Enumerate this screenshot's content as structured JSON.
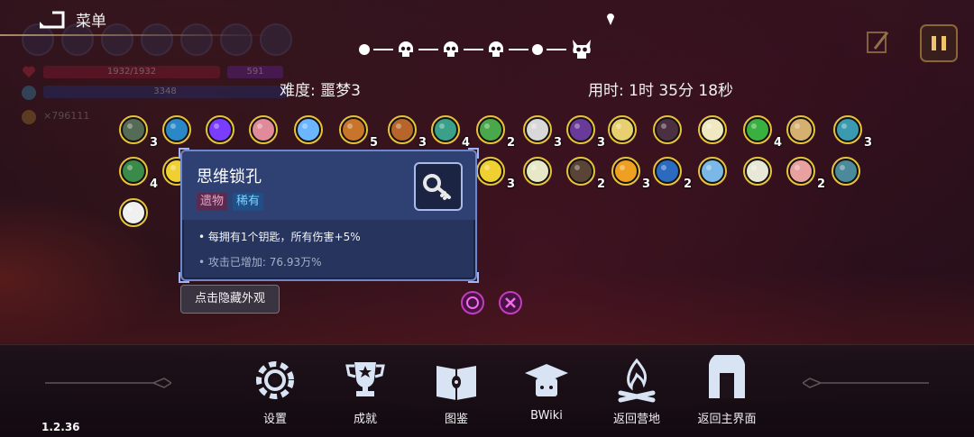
{
  "menu": {
    "label": "菜单"
  },
  "hud": {
    "hp": "1932/1932",
    "shield": "591",
    "mana": "3348",
    "coins": "×796111"
  },
  "progress": {
    "nodes": [
      "dot",
      "skull",
      "skull",
      "skull",
      "dot",
      "boss-skull"
    ]
  },
  "run": {
    "difficulty": "难度: 噩梦3",
    "time": "用时: 1时 35分 18秒"
  },
  "relics": [
    {
      "icon": "gas-mask-icon",
      "count": "3"
    },
    {
      "icon": "magnifier-icon",
      "count": ""
    },
    {
      "icon": "rainbow-cape-icon",
      "count": ""
    },
    {
      "icon": "brain-icon",
      "count": ""
    },
    {
      "icon": "crystal-amulet-icon",
      "count": ""
    },
    {
      "icon": "pickaxe-icon",
      "count": "5"
    },
    {
      "icon": "scroll-icon",
      "count": "3"
    },
    {
      "icon": "sword-icon",
      "count": "4"
    },
    {
      "icon": "leaf-blade-icon",
      "count": "2"
    },
    {
      "icon": "ribcage-icon",
      "count": "3"
    },
    {
      "icon": "robe-icon",
      "count": "3"
    },
    {
      "icon": "goggles-icon",
      "count": ""
    },
    {
      "icon": "dark-cloak-icon",
      "count": ""
    },
    {
      "icon": "wings-icon",
      "count": ""
    },
    {
      "icon": "clover-icon",
      "count": "4"
    },
    {
      "icon": "bread-icon",
      "count": ""
    },
    {
      "icon": "cube-icon",
      "count": "3"
    },
    {
      "icon": "belt-icon",
      "count": "4"
    },
    {
      "icon": "lightning-icon",
      "count": ""
    },
    {
      "icon": "lightning-icon",
      "count": "3"
    },
    {
      "icon": "key-icon",
      "count": ""
    },
    {
      "icon": "cloak-icon",
      "count": "2"
    },
    {
      "icon": "candy-corn-icon",
      "count": "3"
    },
    {
      "icon": "glove-icon",
      "count": "2"
    },
    {
      "icon": "blue-key-icon",
      "count": ""
    },
    {
      "icon": "feather-icon",
      "count": ""
    },
    {
      "icon": "horn-icon",
      "count": "2"
    },
    {
      "icon": "compass-icon",
      "count": ""
    },
    {
      "icon": "mask-icon",
      "count": ""
    }
  ],
  "tooltip": {
    "title": "思维锁孔",
    "tag_relic": "遗物",
    "tag_rare": "稀有",
    "line1": "• 每拥有1个钥匙，所有伤害+5%",
    "line2": "• 攻击已增加: 76.93万%",
    "icon": "key-icon"
  },
  "hide_button": "点击隐藏外观",
  "nav": [
    {
      "label": "设置",
      "icon": "gear-icon"
    },
    {
      "label": "成就",
      "icon": "trophy-icon"
    },
    {
      "label": "图鉴",
      "icon": "book-icon"
    },
    {
      "label": "BWiki",
      "icon": "graduation-cap-icon"
    },
    {
      "label": "返回营地",
      "icon": "campfire-icon"
    },
    {
      "label": "返回主界面",
      "icon": "gate-icon"
    }
  ],
  "version": "1.2.36",
  "colors": {
    "relic_border": "#e8c23a",
    "tooltip_bg": "#26345e",
    "rare_tag": "#7fd0ff",
    "relic_tag": "#e7a6c8"
  }
}
